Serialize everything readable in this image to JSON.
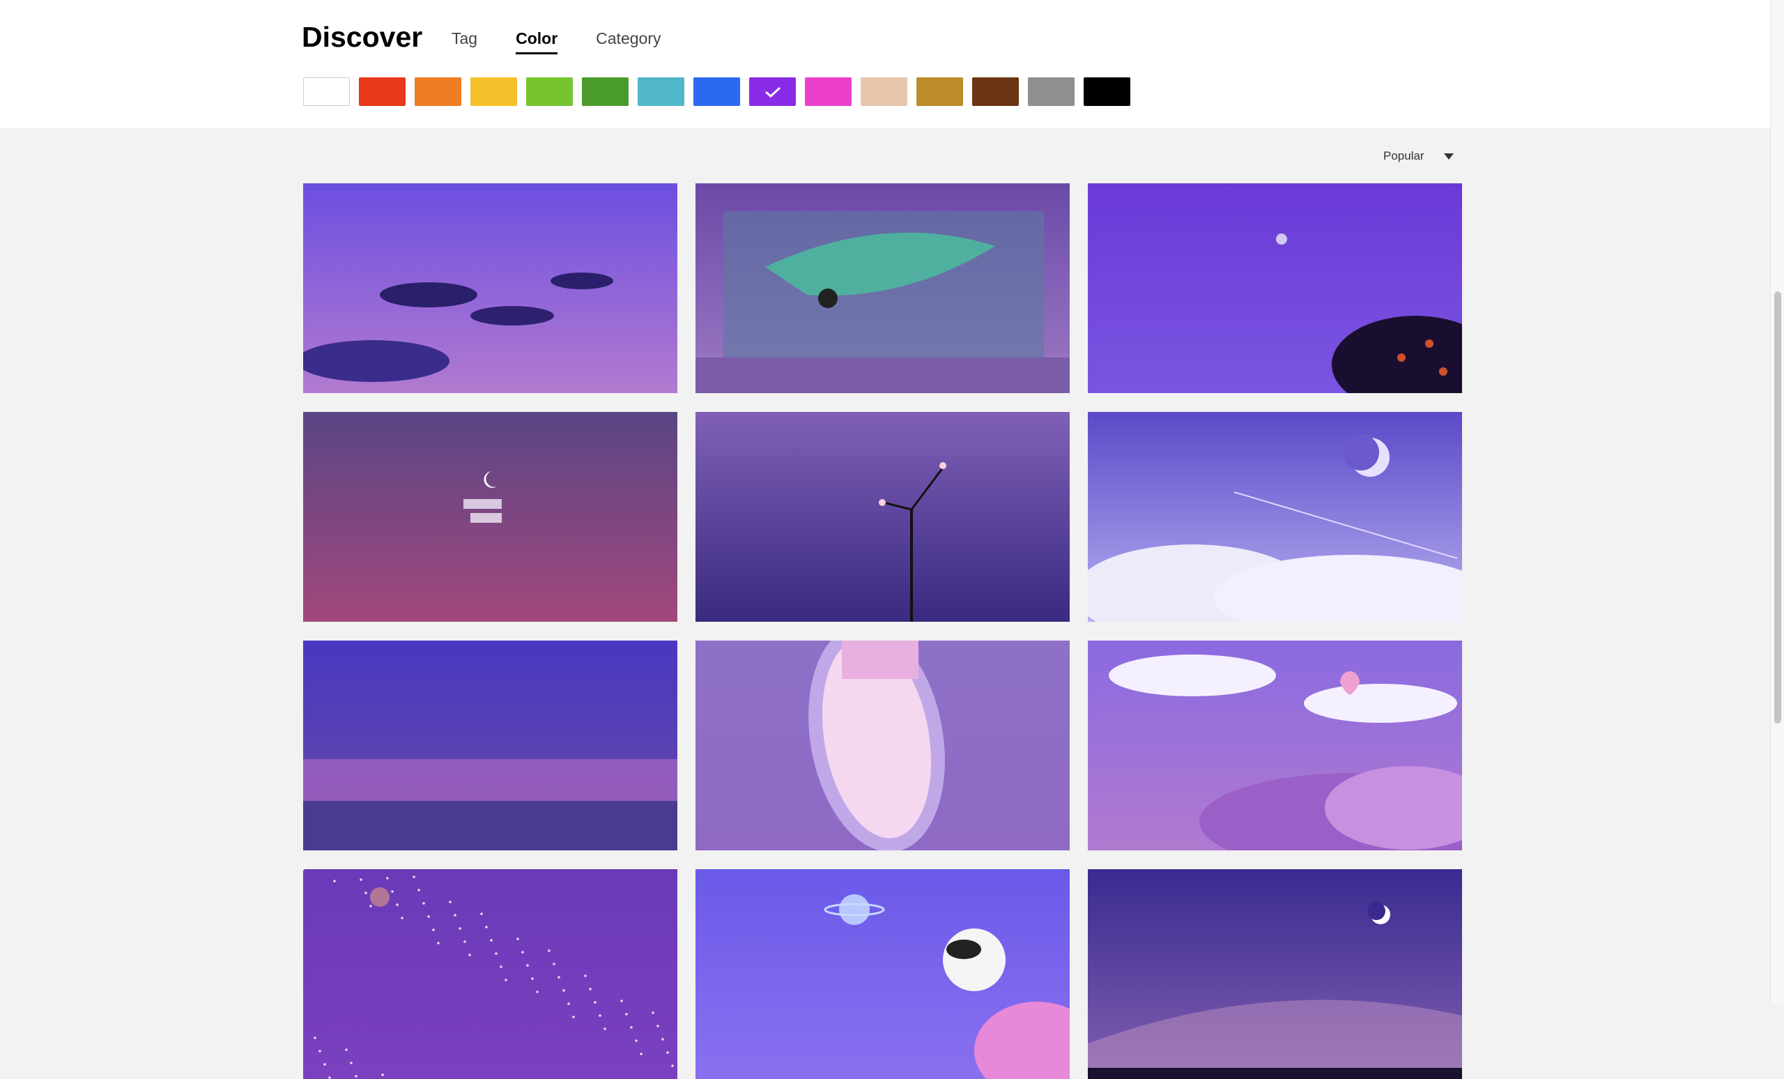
{
  "header": {
    "title": "Discover",
    "tabs": [
      {
        "label": "Tag",
        "active": false
      },
      {
        "label": "Color",
        "active": true
      },
      {
        "label": "Category",
        "active": false
      }
    ]
  },
  "colors": [
    {
      "name": "white",
      "hex": "#ffffff",
      "selected": false
    },
    {
      "name": "red",
      "hex": "#e8391c",
      "selected": false
    },
    {
      "name": "orange",
      "hex": "#ef7c21",
      "selected": false
    },
    {
      "name": "yellow",
      "hex": "#f5c02a",
      "selected": false
    },
    {
      "name": "light-green",
      "hex": "#76c42e",
      "selected": false
    },
    {
      "name": "green",
      "hex": "#4a9c2a",
      "selected": false
    },
    {
      "name": "teal",
      "hex": "#4fb7c8",
      "selected": false
    },
    {
      "name": "blue",
      "hex": "#2a6af0",
      "selected": false
    },
    {
      "name": "purple",
      "hex": "#8a2be8",
      "selected": true
    },
    {
      "name": "pink",
      "hex": "#ec3fcb",
      "selected": false
    },
    {
      "name": "beige",
      "hex": "#e6c7ad",
      "selected": false
    },
    {
      "name": "gold",
      "hex": "#bd8c2a",
      "selected": false
    },
    {
      "name": "brown",
      "hex": "#6b3415",
      "selected": false
    },
    {
      "name": "gray",
      "hex": "#8f8f8f",
      "selected": false
    },
    {
      "name": "black",
      "hex": "#000000",
      "selected": false
    }
  ],
  "sort": {
    "label": "Popular"
  },
  "wallpapers": [
    {
      "name": "purple-dusk-clouds",
      "top": "#6c4fe0",
      "bottom": "#b27ad0"
    },
    {
      "name": "whale-window-illustration",
      "top": "#6b4aa8",
      "bottom": "#9c7ac4"
    },
    {
      "name": "night-sky-trees",
      "top": "#6a3ad8",
      "bottom": "#7a55e0"
    },
    {
      "name": "moon-korean-text",
      "top": "#5a4585",
      "bottom": "#a2487c"
    },
    {
      "name": "street-lamp",
      "top": "#8060b8",
      "bottom": "#3a2a80"
    },
    {
      "name": "moon-clouds-contrail",
      "top": "#5a4ac8",
      "bottom": "#b8b0f0"
    },
    {
      "name": "purple-ocean-horizon",
      "top": "#4838c0",
      "bottom": "#6a4aa8"
    },
    {
      "name": "airplane-window",
      "top": "#8e70c8",
      "bottom": "#8e6ac4"
    },
    {
      "name": "hot-air-balloons",
      "top": "#8a6ae0",
      "bottom": "#b07ad0"
    },
    {
      "name": "starry-purple",
      "top": "#6a3ab8",
      "bottom": "#7a40c0"
    },
    {
      "name": "planet-dog-illustration",
      "top": "#6a5ae8",
      "bottom": "#8a70f0"
    },
    {
      "name": "galaxy-moon-night",
      "top": "#3a2a90",
      "bottom": "#8060b0"
    }
  ]
}
